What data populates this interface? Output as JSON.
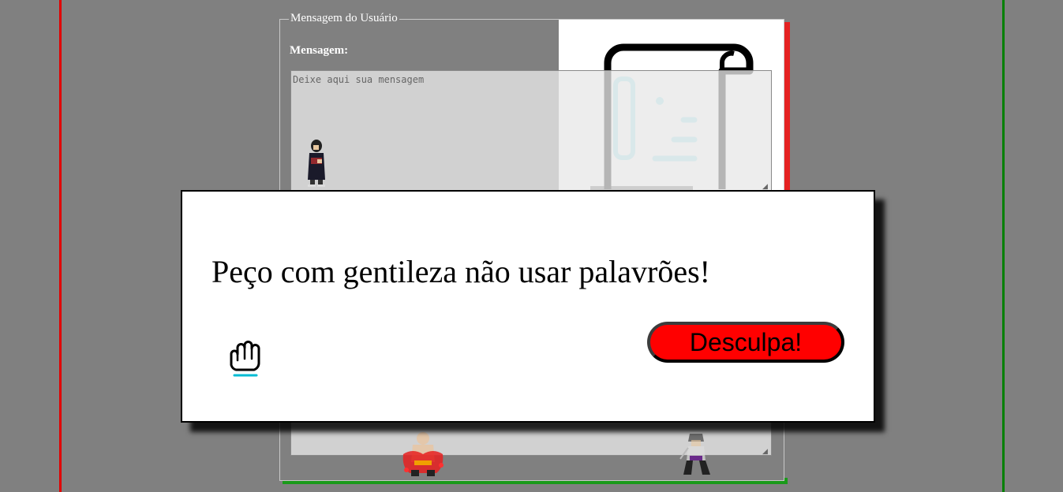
{
  "form": {
    "legend": "Mensagem do Usuário",
    "message_label": "Mensagem:",
    "message_placeholder": "Deixe aqui sua mensagem",
    "message_value": ""
  },
  "dialog": {
    "message": "Peço com gentileza não usar palavrões!",
    "button_label": "Desculpa!",
    "icon": "raised-fist-icon"
  },
  "colors": {
    "page_background": "#808080",
    "left_accent": "#e00000",
    "right_accent": "#008000",
    "button_background": "#ff0000",
    "scroll_icon_accent": "#00bcd4"
  }
}
